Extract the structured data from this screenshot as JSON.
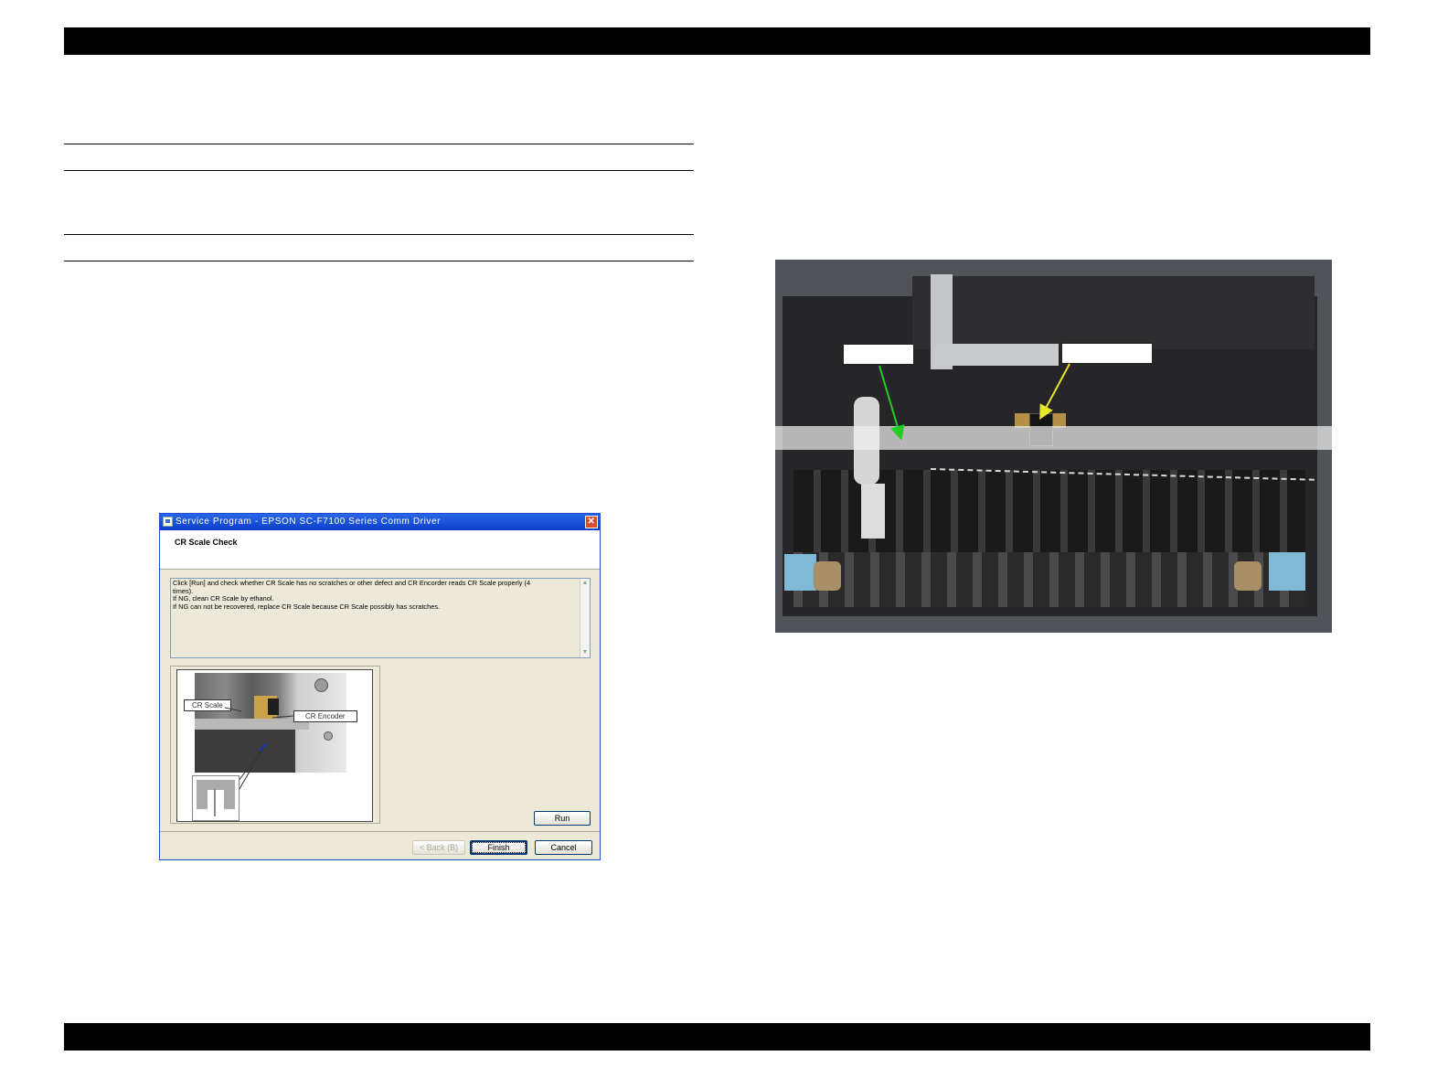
{
  "dialog": {
    "title": "Service Program - EPSON SC-F7100 Series Comm Driver",
    "heading": "CR Scale Check",
    "message_lines": [
      "Click [Run] and check whether CR Scale has no scratches or other defect and CR Encorder reads CR Scale properly (4",
      "times).",
      "If NG, clean CR Scale by ethanol.",
      "If NG can not be recovered, replace CR Scale because CR Scale possibly has scratches."
    ],
    "image_labels": {
      "scale": "CR Scale",
      "encoder": "CR Encoder"
    },
    "buttons": {
      "run": "Run",
      "back": "< Back (B)",
      "finish": "Finish",
      "cancel": "Cancel"
    },
    "close_glyph": "✕"
  },
  "icons": {
    "app": "app-icon",
    "close": "close-icon"
  },
  "colors": {
    "title_bar": "#0a3fc8",
    "dialog_face": "#ece9d8",
    "scale_arrow": "#22cc22",
    "encoder_arrow": "#e6e62a"
  }
}
